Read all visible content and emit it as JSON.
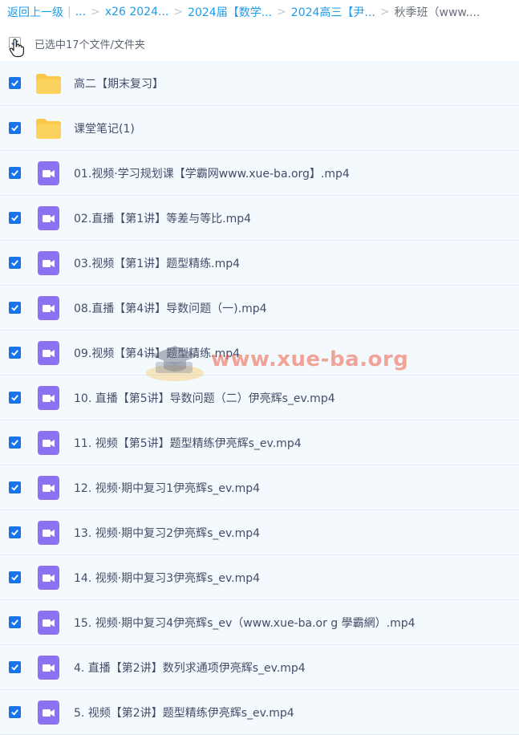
{
  "breadcrumb": {
    "back_label": "返回上一级",
    "ellipsis": "...",
    "items": [
      "x26 2024...",
      "2024届【数学...",
      "2024高三【尹..."
    ],
    "current": "秋季班（www...."
  },
  "selection": {
    "label": "已选中17个文件/文件夹"
  },
  "files": [
    {
      "name": "高二【期末复习】",
      "type": "folder"
    },
    {
      "name": "课堂笔记(1)",
      "type": "folder"
    },
    {
      "name": "01.视频·学习规划课【学霸网www.xue-ba.org】.mp4",
      "type": "video"
    },
    {
      "name": "02.直播【第1讲】等差与等比.mp4",
      "type": "video"
    },
    {
      "name": "03.视频【第1讲】题型精练.mp4",
      "type": "video"
    },
    {
      "name": "08.直播【第4讲】导数问题（一).mp4",
      "type": "video"
    },
    {
      "name": "09.视频【第4讲】题型精练.mp4",
      "type": "video"
    },
    {
      "name": "10. 直播【第5讲】导数问题（二）伊亮辉s_ev.mp4",
      "type": "video"
    },
    {
      "name": "11. 视频【第5讲】题型精练伊亮辉s_ev.mp4",
      "type": "video"
    },
    {
      "name": "12. 视频·期中复习1伊亮辉s_ev.mp4",
      "type": "video"
    },
    {
      "name": "13. 视频·期中复习2伊亮辉s_ev.mp4",
      "type": "video"
    },
    {
      "name": "14. 视频·期中复习3伊亮辉s_ev.mp4",
      "type": "video"
    },
    {
      "name": "15. 视频·期中复习4伊亮辉s_ev（www.xue-ba.or g 學霸網）.mp4",
      "type": "video"
    },
    {
      "name": "4. 直播【第2讲】数列求通项伊亮辉s_ev.mp4",
      "type": "video"
    },
    {
      "name": "5. 视频【第2讲】题型精练伊亮辉s_ev.mp4",
      "type": "video"
    }
  ],
  "watermark": {
    "text": "www.xue-ba.org"
  },
  "colors": {
    "accent": "#1a73e8",
    "link": "#1e9be8",
    "folder": "#fbc94a",
    "video": "#8b72f0",
    "row_bg": "#f4f9fe"
  }
}
